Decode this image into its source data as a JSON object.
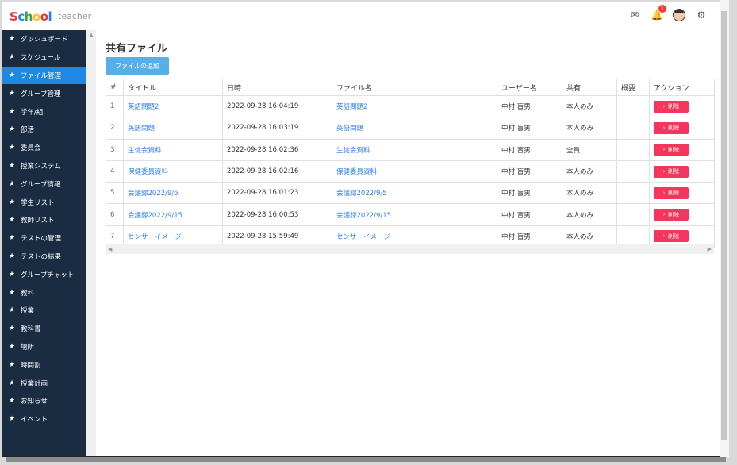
{
  "app": {
    "logo_letters": [
      "S",
      "c",
      "h",
      "o",
      "o",
      "l"
    ],
    "logo_colors": [
      "#e53935",
      "#1e88e5",
      "#43a047",
      "#fbc02d",
      "#e53935",
      "#1e88e5"
    ],
    "role": "teacher"
  },
  "header": {
    "notification_count": "1"
  },
  "sidebar": {
    "items": [
      {
        "label": "ダッシュボード"
      },
      {
        "label": "スケジュール"
      },
      {
        "label": "ファイル管理"
      },
      {
        "label": "グループ管理"
      },
      {
        "label": "学年/組"
      },
      {
        "label": "部活"
      },
      {
        "label": "委員会"
      },
      {
        "label": "授業システム"
      },
      {
        "label": "グループ情報"
      },
      {
        "label": "学生リスト"
      },
      {
        "label": "教師リスト"
      },
      {
        "label": "テストの管理"
      },
      {
        "label": "テストの結果"
      },
      {
        "label": "グループチャット"
      },
      {
        "label": "教科"
      },
      {
        "label": "授業"
      },
      {
        "label": "教科書"
      },
      {
        "label": "場所"
      },
      {
        "label": "時間割"
      },
      {
        "label": "授業計画"
      },
      {
        "label": "お知らせ"
      },
      {
        "label": "イベント"
      }
    ]
  },
  "main": {
    "title": "共有ファイル",
    "add_button": "ファイルの追加",
    "columns": [
      "#",
      "タイトル",
      "日時",
      "ファイル名",
      "ユーザー名",
      "共有",
      "概要",
      "アクション"
    ],
    "delete_label": "削除",
    "rows": [
      {
        "n": "1",
        "title": "英語問題2",
        "date": "2022-09-28 16:04:19",
        "file": "英語問題2",
        "user": "中村 盲男",
        "share": "本人のみ",
        "summary": ""
      },
      {
        "n": "2",
        "title": "英語問題",
        "date": "2022-09-28 16:03:19",
        "file": "英語問題",
        "user": "中村 盲男",
        "share": "本人のみ",
        "summary": ""
      },
      {
        "n": "3",
        "title": "生徒会資料",
        "date": "2022-09-28 16:02:36",
        "file": "生徒会資料",
        "user": "中村 盲男",
        "share": "全員",
        "summary": ""
      },
      {
        "n": "4",
        "title": "保健委員資料",
        "date": "2022-09-28 16:02:16",
        "file": "保健委員資料",
        "user": "中村 盲男",
        "share": "本人のみ",
        "summary": ""
      },
      {
        "n": "5",
        "title": "会議録2022/9/5",
        "date": "2022-09-28 16:01:23",
        "file": "会議録2022/9/5",
        "user": "中村 盲男",
        "share": "本人のみ",
        "summary": ""
      },
      {
        "n": "6",
        "title": "会議録2022/9/15",
        "date": "2022-09-28 16:00:53",
        "file": "会議録2022/9/15",
        "user": "中村 盲男",
        "share": "本人のみ",
        "summary": ""
      },
      {
        "n": "7",
        "title": "センサーイメージ",
        "date": "2022-09-28 15:59:49",
        "file": "センサーイメージ",
        "user": "中村 盲男",
        "share": "本人のみ",
        "summary": ""
      }
    ]
  }
}
